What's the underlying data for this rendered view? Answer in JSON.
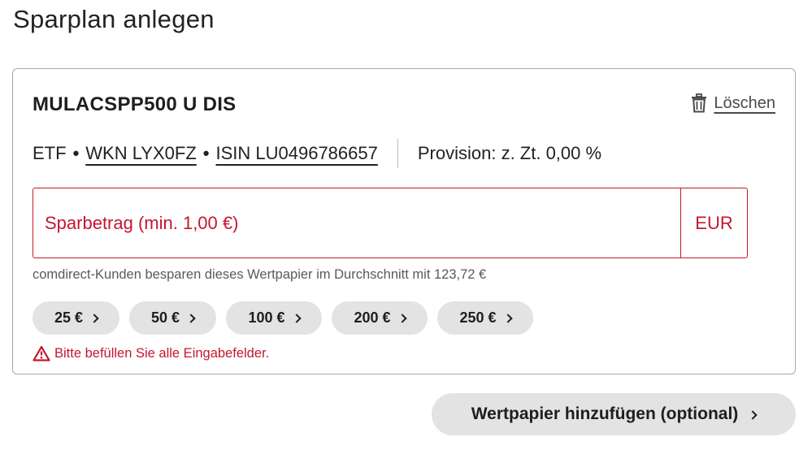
{
  "page": {
    "title": "Sparplan anlegen"
  },
  "security": {
    "name": "MULACSPP500 U DIS",
    "type": "ETF",
    "wkn": "WKN LYX0FZ",
    "isin": "ISIN LU0496786657",
    "commission": "Provision: z. Zt. 0,00 %"
  },
  "delete": {
    "label": "Löschen",
    "icon": "trash-icon"
  },
  "amount": {
    "placeholder": "Sparbetrag (min. 1,00 €)",
    "value": "",
    "currency": "EUR"
  },
  "hint": "comdirect-Kunden besparen dieses Wertpapier im Durchschnitt mit 123,72 €",
  "quick_amounts": [
    "25 €",
    "50 €",
    "100 €",
    "200 €",
    "250 €"
  ],
  "error": {
    "text": "Bitte befüllen Sie alle Eingabefelder.",
    "icon": "warning-icon"
  },
  "add_security": {
    "label": "Wertpapier hinzufügen (optional)"
  },
  "colors": {
    "error": "#c4172f",
    "chip_bg": "#e3e3e3",
    "border": "#a9a9a9"
  }
}
